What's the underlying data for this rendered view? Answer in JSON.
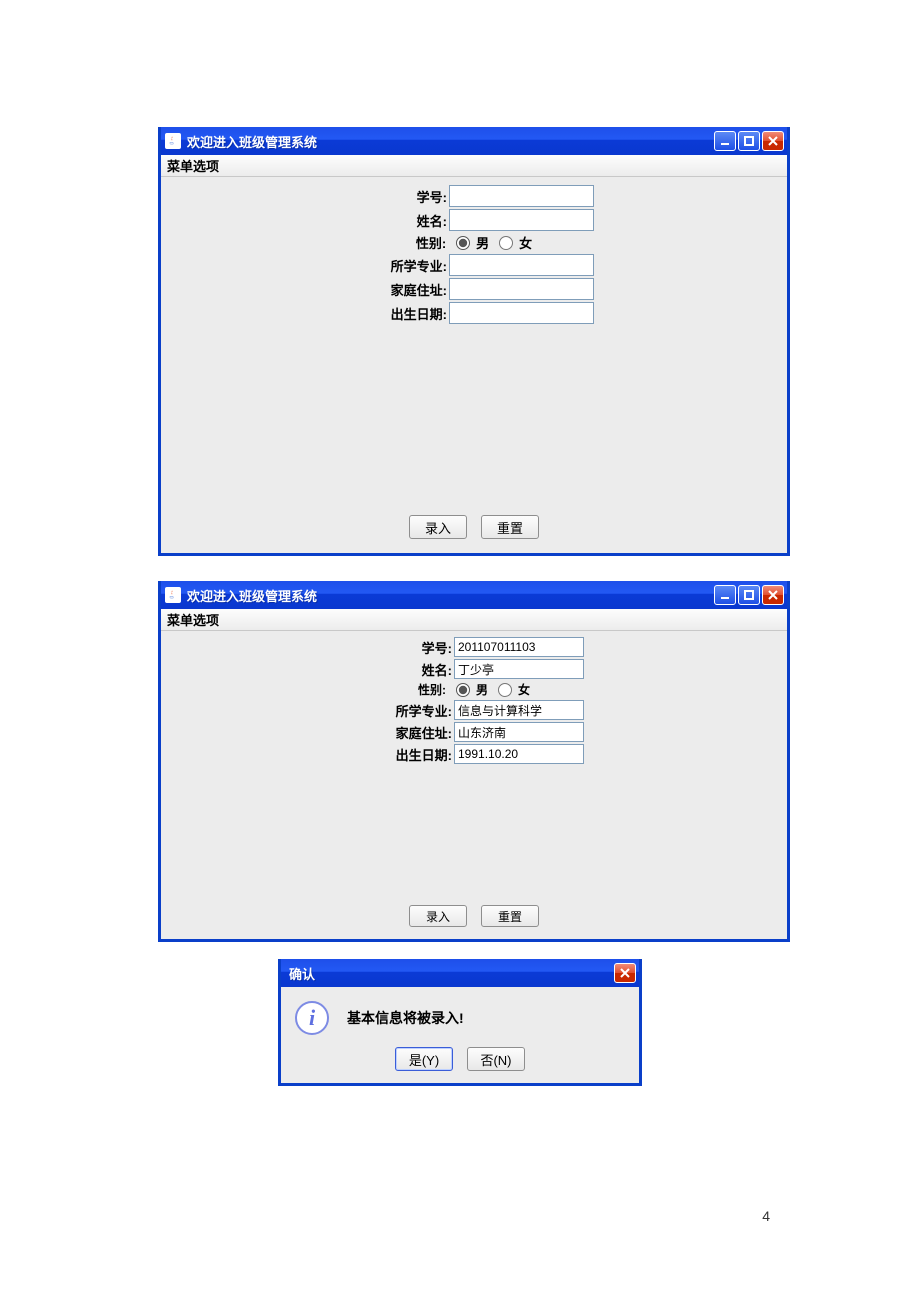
{
  "page_number": "4",
  "window1": {
    "title": "欢迎进入班级管理系统",
    "menu": "菜单选项",
    "fields": {
      "student_id_label": "学号:",
      "student_id_value": "",
      "name_label": "姓名:",
      "name_value": "",
      "gender_label": "性别:",
      "gender_male": "男",
      "gender_female": "女",
      "major_label": "所学专业:",
      "major_value": "",
      "address_label": "家庭住址:",
      "address_value": "",
      "birth_label": "出生日期:",
      "birth_value": ""
    },
    "buttons": {
      "submit": "录入",
      "reset": "重置"
    }
  },
  "window2": {
    "title": "欢迎进入班级管理系统",
    "menu": "菜单选项",
    "fields": {
      "student_id_label": "学号:",
      "student_id_value": "201107011103",
      "name_label": "姓名:",
      "name_value": "丁少亭",
      "gender_label": "性别:",
      "gender_male": "男",
      "gender_female": "女",
      "major_label": "所学专业:",
      "major_value": "信息与计算科学",
      "address_label": "家庭住址:",
      "address_value": "山东济南",
      "birth_label": "出生日期:",
      "birth_value": "1991.10.20"
    },
    "buttons": {
      "submit": "录入",
      "reset": "重置"
    }
  },
  "dialog": {
    "title": "确认",
    "message": "基本信息将被录入!",
    "yes": "是(Y)",
    "no": "否(N)"
  }
}
